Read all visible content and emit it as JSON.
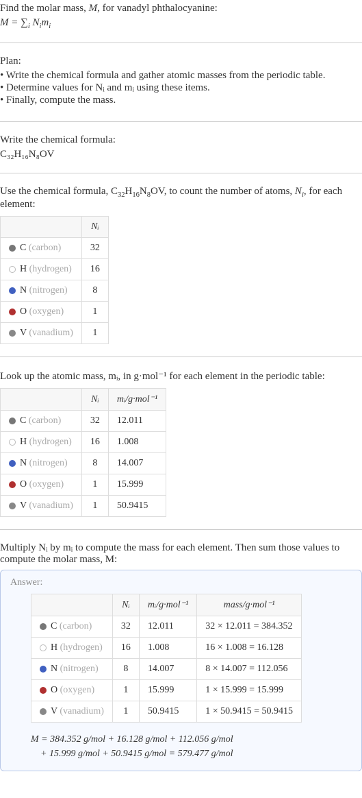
{
  "header": {
    "line1_pre": "Find the molar mass, ",
    "line1_M": "M",
    "line1_post": ", for vanadyl phthalocyanine:",
    "formula": "M = ∑",
    "formula_sub": "i",
    "formula_rhs_pre": " N",
    "formula_rhs_sub1": "i",
    "formula_rhs_mid": "m",
    "formula_rhs_sub2": "i"
  },
  "plan": {
    "title": "Plan:",
    "items": [
      "• Write the chemical formula and gather atomic masses from the periodic table.",
      "• Determine values for Nᵢ and mᵢ using these items.",
      "• Finally, compute the mass."
    ]
  },
  "write_formula": {
    "title": "Write the chemical formula:",
    "formula_html": "C₃₂H₁₆N₈OV"
  },
  "count_atoms": {
    "intro_pre": "Use the chemical formula, C",
    "f_c": "32",
    "intro_h": "H",
    "f_h": "16",
    "intro_n": "N",
    "f_n": "8",
    "intro_rest": "OV, to count the number of atoms, ",
    "intro_Ni": "N",
    "intro_Ni_sub": "i",
    "intro_post": ", for each element:",
    "header_ni": "Nᵢ",
    "rows": [
      {
        "sym": "C",
        "name": "(carbon)",
        "dot": "dot-c",
        "ni": "32"
      },
      {
        "sym": "H",
        "name": "(hydrogen)",
        "dot": "dot-h",
        "ni": "16"
      },
      {
        "sym": "N",
        "name": "(nitrogen)",
        "dot": "dot-n",
        "ni": "8"
      },
      {
        "sym": "O",
        "name": "(oxygen)",
        "dot": "dot-o",
        "ni": "1"
      },
      {
        "sym": "V",
        "name": "(vanadium)",
        "dot": "dot-v",
        "ni": "1"
      }
    ]
  },
  "atomic_mass": {
    "intro": "Look up the atomic mass, mᵢ, in g·mol⁻¹ for each element in the periodic table:",
    "header_ni": "Nᵢ",
    "header_mi": "mᵢ/g·mol⁻¹",
    "rows": [
      {
        "sym": "C",
        "name": "(carbon)",
        "dot": "dot-c",
        "ni": "32",
        "mi": "12.011"
      },
      {
        "sym": "H",
        "name": "(hydrogen)",
        "dot": "dot-h",
        "ni": "16",
        "mi": "1.008"
      },
      {
        "sym": "N",
        "name": "(nitrogen)",
        "dot": "dot-n",
        "ni": "8",
        "mi": "14.007"
      },
      {
        "sym": "O",
        "name": "(oxygen)",
        "dot": "dot-o",
        "ni": "1",
        "mi": "15.999"
      },
      {
        "sym": "V",
        "name": "(vanadium)",
        "dot": "dot-v",
        "ni": "1",
        "mi": "50.9415"
      }
    ]
  },
  "multiply": {
    "intro": "Multiply Nᵢ by mᵢ to compute the mass for each element. Then sum those values to compute the molar mass, M:"
  },
  "answer": {
    "label": "Answer:",
    "header_ni": "Nᵢ",
    "header_mi": "mᵢ/g·mol⁻¹",
    "header_mass": "mass/g·mol⁻¹",
    "rows": [
      {
        "sym": "C",
        "name": "(carbon)",
        "dot": "dot-c",
        "ni": "32",
        "mi": "12.011",
        "mass": "32 × 12.011 = 384.352"
      },
      {
        "sym": "H",
        "name": "(hydrogen)",
        "dot": "dot-h",
        "ni": "16",
        "mi": "1.008",
        "mass": "16 × 1.008 = 16.128"
      },
      {
        "sym": "N",
        "name": "(nitrogen)",
        "dot": "dot-n",
        "ni": "8",
        "mi": "14.007",
        "mass": "8 × 14.007 = 112.056"
      },
      {
        "sym": "O",
        "name": "(oxygen)",
        "dot": "dot-o",
        "ni": "1",
        "mi": "15.999",
        "mass": "1 × 15.999 = 15.999"
      },
      {
        "sym": "V",
        "name": "(vanadium)",
        "dot": "dot-v",
        "ni": "1",
        "mi": "50.9415",
        "mass": "1 × 50.9415 = 50.9415"
      }
    ],
    "sum_line1": "M = 384.352 g/mol + 16.128 g/mol + 112.056 g/mol",
    "sum_line2": "+ 15.999 g/mol + 50.9415 g/mol = 579.477 g/mol"
  }
}
